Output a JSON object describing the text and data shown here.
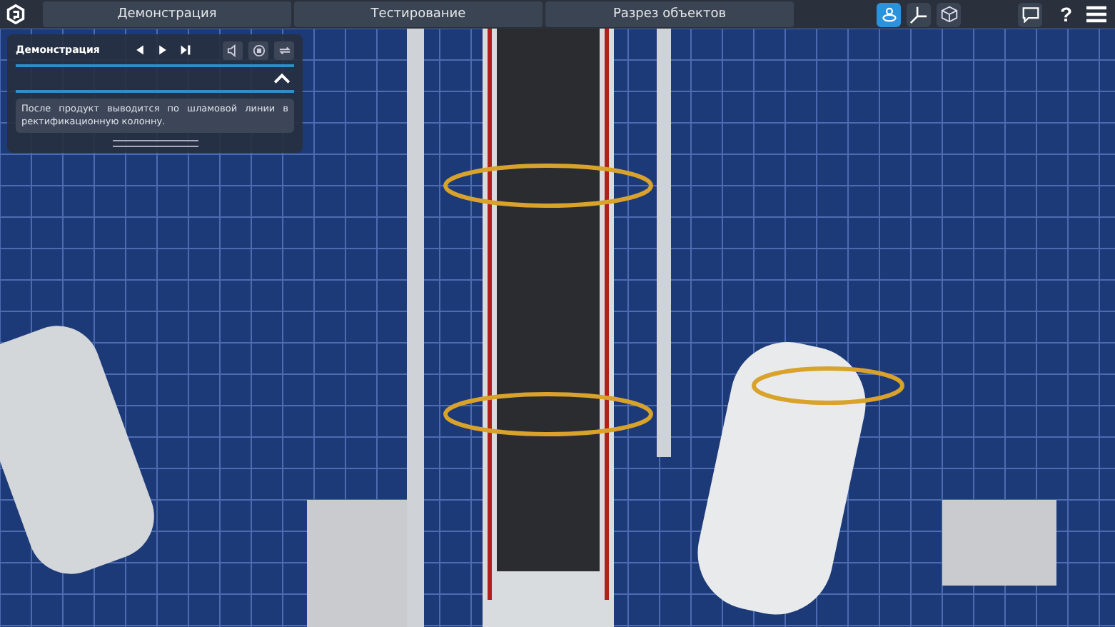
{
  "tabs": [
    {
      "label": "Демонстрация",
      "selected": false
    },
    {
      "label": "Тестирование",
      "selected": false
    },
    {
      "label": "Разрез объектов",
      "selected": false
    }
  ],
  "view_tools": [
    {
      "kind": "person",
      "selected": true
    },
    {
      "kind": "axes",
      "selected": false
    },
    {
      "kind": "cube",
      "selected": false
    }
  ],
  "help": {
    "label": "?"
  },
  "panel": {
    "title": "Демонстрация",
    "text": "После продукт выводится по шламовой линии в ректификационную колонну.",
    "expanded": true
  }
}
